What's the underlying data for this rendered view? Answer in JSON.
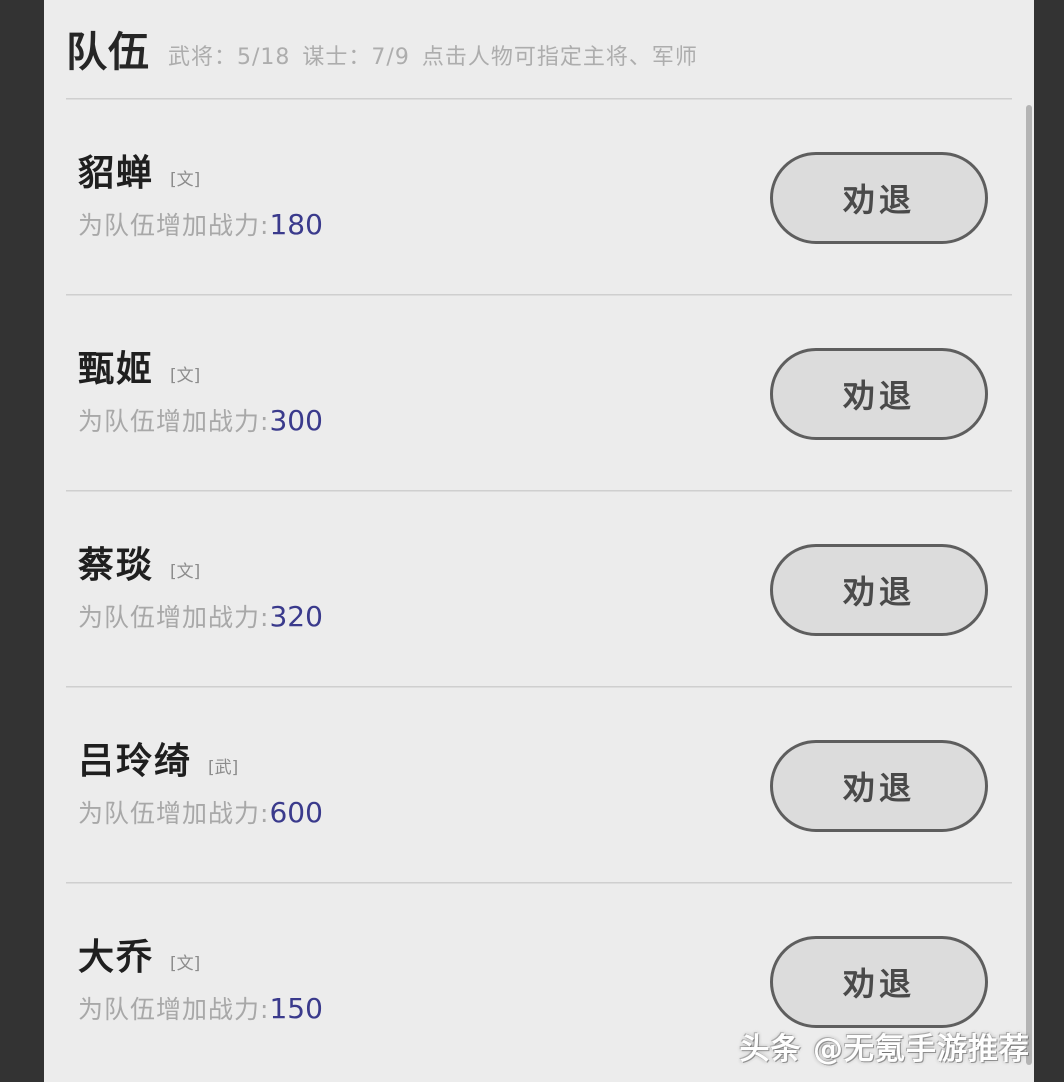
{
  "header": {
    "title": "队伍",
    "stats_warrior": "武将：5/18",
    "stats_strategist": "谋士：7/9",
    "hint": "点击人物可指定主将、军师"
  },
  "list": {
    "power_label": "为队伍增加战力:",
    "dismiss_label": "劝退",
    "rows": [
      {
        "name": "貂蝉",
        "tag": "[文]",
        "power": "180"
      },
      {
        "name": "甄姬",
        "tag": "[文]",
        "power": "300"
      },
      {
        "name": "蔡琰",
        "tag": "[文]",
        "power": "320"
      },
      {
        "name": "吕玲绮",
        "tag": "[武]",
        "power": "600"
      },
      {
        "name": "大乔",
        "tag": "[文]",
        "power": "150"
      }
    ]
  },
  "watermark": {
    "text": "头条 @无氪手游推荐"
  },
  "colors": {
    "panel_bg": "#ececec",
    "chrome": "#333333",
    "power_value": "#3a3a8c",
    "muted_text": "#a8a8a8",
    "button_fill": "#dcdcdc",
    "button_border": "#5e5e5e"
  }
}
